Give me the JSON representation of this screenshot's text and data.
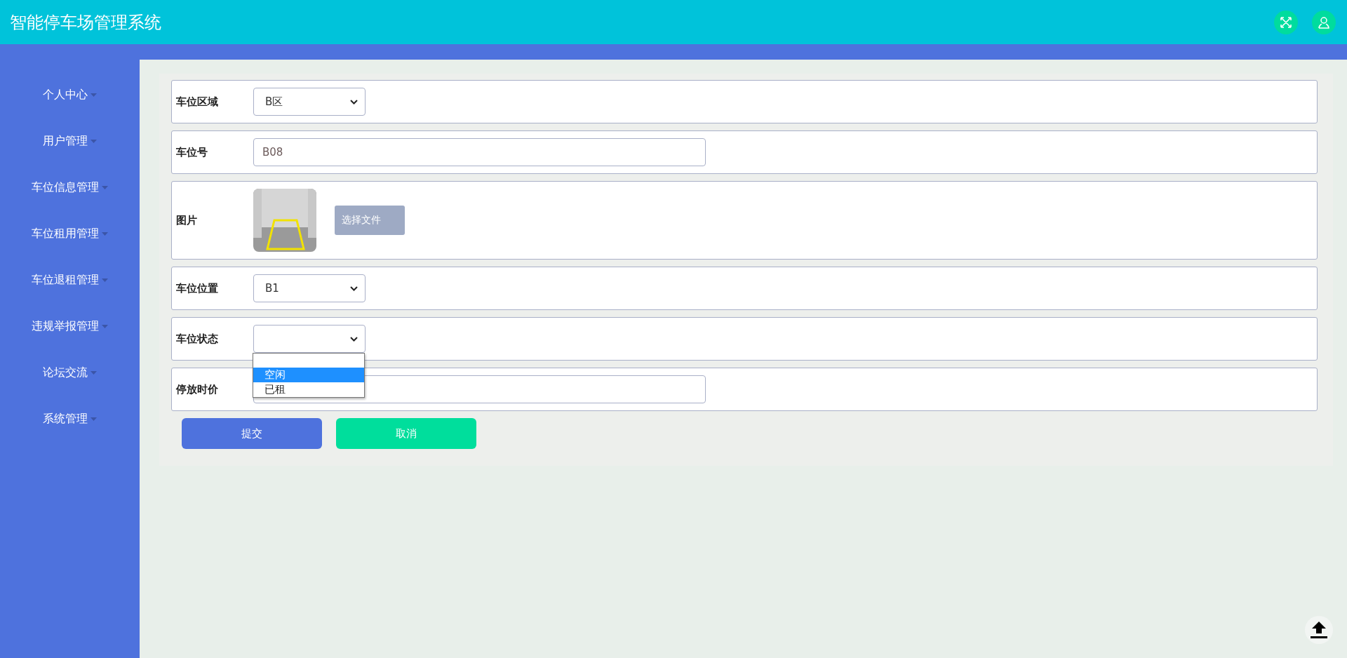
{
  "header": {
    "title": "智能停车场管理系统"
  },
  "sidebar": {
    "items": [
      {
        "label": "个人中心"
      },
      {
        "label": "用户管理"
      },
      {
        "label": "车位信息管理"
      },
      {
        "label": "车位租用管理"
      },
      {
        "label": "车位退租管理"
      },
      {
        "label": "违规举报管理"
      },
      {
        "label": "论坛交流"
      },
      {
        "label": "系统管理"
      }
    ]
  },
  "form": {
    "fields": [
      {
        "kind": "select",
        "label": "车位区域",
        "value": "B区"
      },
      {
        "kind": "input",
        "label": "车位号",
        "value": "B08"
      },
      {
        "kind": "image",
        "label": "图片",
        "button": "选择文件"
      },
      {
        "kind": "select",
        "label": "车位位置",
        "value": "B1"
      },
      {
        "kind": "select",
        "label": "车位状态",
        "open": true,
        "options": [
          {
            "label": "空闲",
            "selected": true
          },
          {
            "label": "已租",
            "selected": false
          }
        ]
      },
      {
        "kind": "input",
        "label": "停放时价"
      }
    ],
    "buttons": [
      {
        "label": "提交",
        "kind": "primary"
      },
      {
        "label": "取消",
        "kind": "secondary"
      }
    ]
  }
}
